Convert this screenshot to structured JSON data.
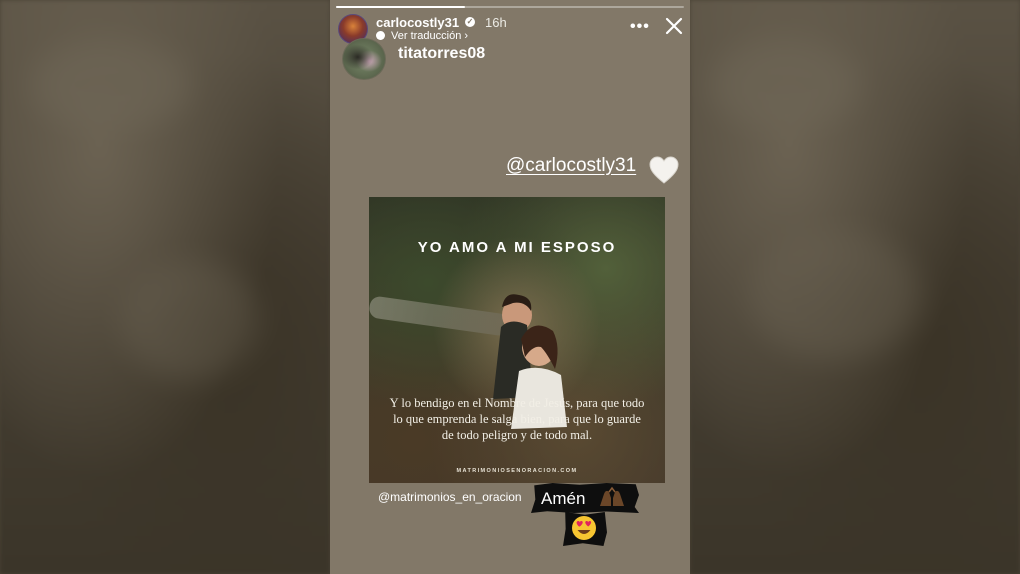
{
  "story": {
    "progress": 0.37,
    "header": {
      "username": "carlocostly31",
      "time": "16h",
      "translate_label": "Ver traducción",
      "translate_chevron": "›",
      "more_label": "•••"
    },
    "tagged_user": "titatorres08",
    "mention": "@carlocostly31",
    "post": {
      "heading": "YO AMO A MI ESPOSO",
      "quote": "Y lo bendigo en el Nombre de Jesús, para que todo lo que emprenda le salga bien, para que lo guarde de todo peligro y de todo mal.",
      "site": "MATRIMONIOSENORACION.COM"
    },
    "source_handle": "@matrimonios_en_oracion",
    "amen_text": "Amén",
    "icons": [
      "verified-icon",
      "translate-icon",
      "more-icon",
      "close-icon",
      "white-heart-icon",
      "praying-hands-icon",
      "heart-eyes-icon"
    ],
    "colors": {
      "story_bg": "#827868",
      "page_bg": "#4a4336",
      "text": "#ffffff",
      "sticker_bg": "#0e0e0e"
    }
  }
}
